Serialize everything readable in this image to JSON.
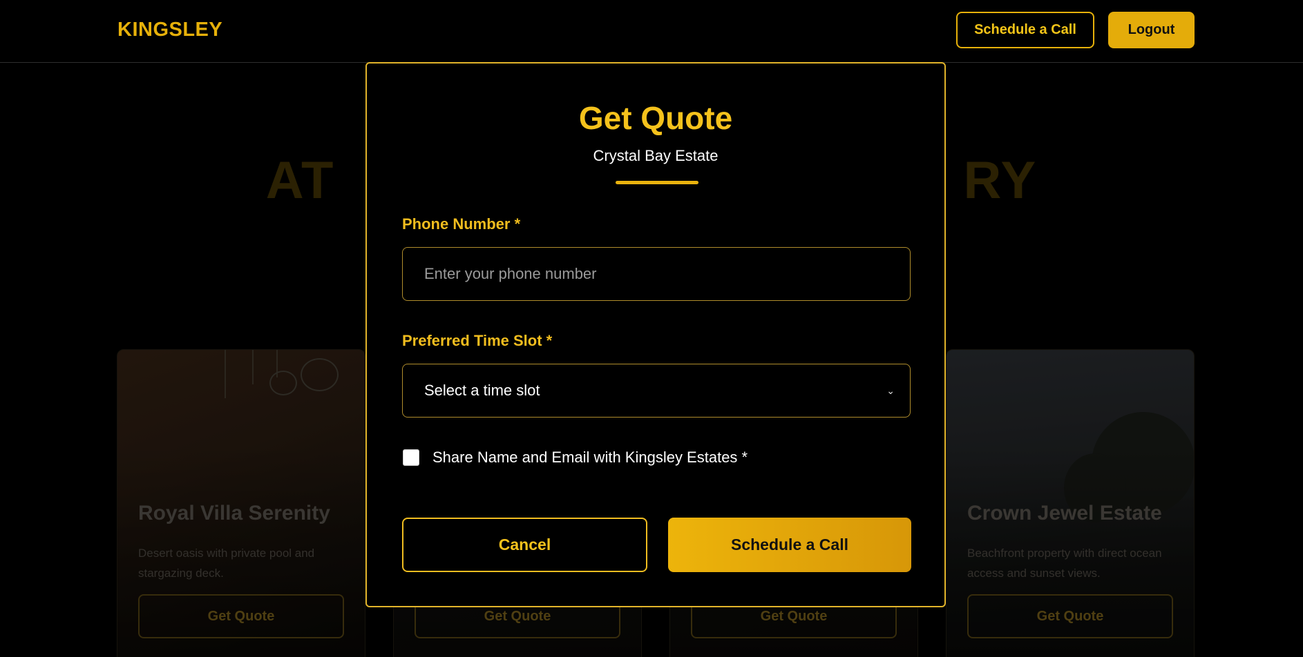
{
  "header": {
    "logo": "KINGSLEY",
    "schedule_label": "Schedule a Call",
    "logout_label": "Logout"
  },
  "background": {
    "heading_left": "AT",
    "heading_right": "RY",
    "cards": [
      {
        "title": "Royal Villa Serenity",
        "description": "Desert oasis with private pool and stargazing deck.",
        "button": "Get Quote"
      },
      {
        "title": "",
        "description": "",
        "button": "Get Quote"
      },
      {
        "title": "",
        "description": "",
        "button": "Get Quote"
      },
      {
        "title": "Crown Jewel Estate",
        "description": "Beachfront property with direct ocean access and sunset views.",
        "button": "Get Quote"
      }
    ]
  },
  "modal": {
    "title": "Get Quote",
    "subtitle": "Crystal Bay Estate",
    "phone_label": "Phone Number *",
    "phone_placeholder": "Enter your phone number",
    "phone_value": "",
    "slot_label": "Preferred Time Slot *",
    "slot_selected": "Select a time slot",
    "consent_label": "Share Name and Email with Kingsley Estates *",
    "consent_checked": false,
    "cancel_label": "Cancel",
    "submit_label": "Schedule a Call"
  },
  "colors": {
    "accent": "#e7b10a",
    "accent_text": "#f5c21c",
    "background": "#000000"
  }
}
